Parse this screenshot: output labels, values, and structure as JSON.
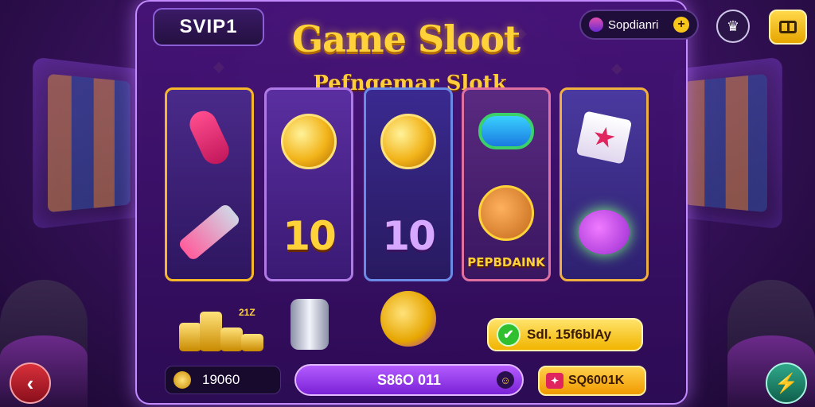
{
  "header": {
    "vip_label": "SVIP1",
    "username": "Sopdianri",
    "plus_symbol": "+"
  },
  "title": {
    "main": "Game Sloot",
    "sub": "Pefngemar Slotk"
  },
  "reels": [
    {
      "top_icon": "horn-icon",
      "bottom_icon": "battery-icon"
    },
    {
      "top_icon": "gold-coin-icon",
      "bottom_text": "10"
    },
    {
      "top_icon": "smiley-coin-icon",
      "bottom_text": "10"
    },
    {
      "top_icon": "gem-icon",
      "bottom_label": "PEPBDAINK"
    },
    {
      "top_icon": "gift-box-icon",
      "bottom_icon": "purple-creature-icon"
    }
  ],
  "bonus_row": {
    "coin_stack_note": "21Z",
    "reward_button": "Sdl. 15f6blAy"
  },
  "footer": {
    "balance": "19060",
    "spin_label": "S86O 011",
    "bet_label": "SQ6001K"
  },
  "colors": {
    "accent_gold": "#ffd23a",
    "panel_purple": "#461478",
    "spin_purple": "#9b40ee",
    "back_red": "#d8303a",
    "bolt_teal": "#2fa88a"
  }
}
